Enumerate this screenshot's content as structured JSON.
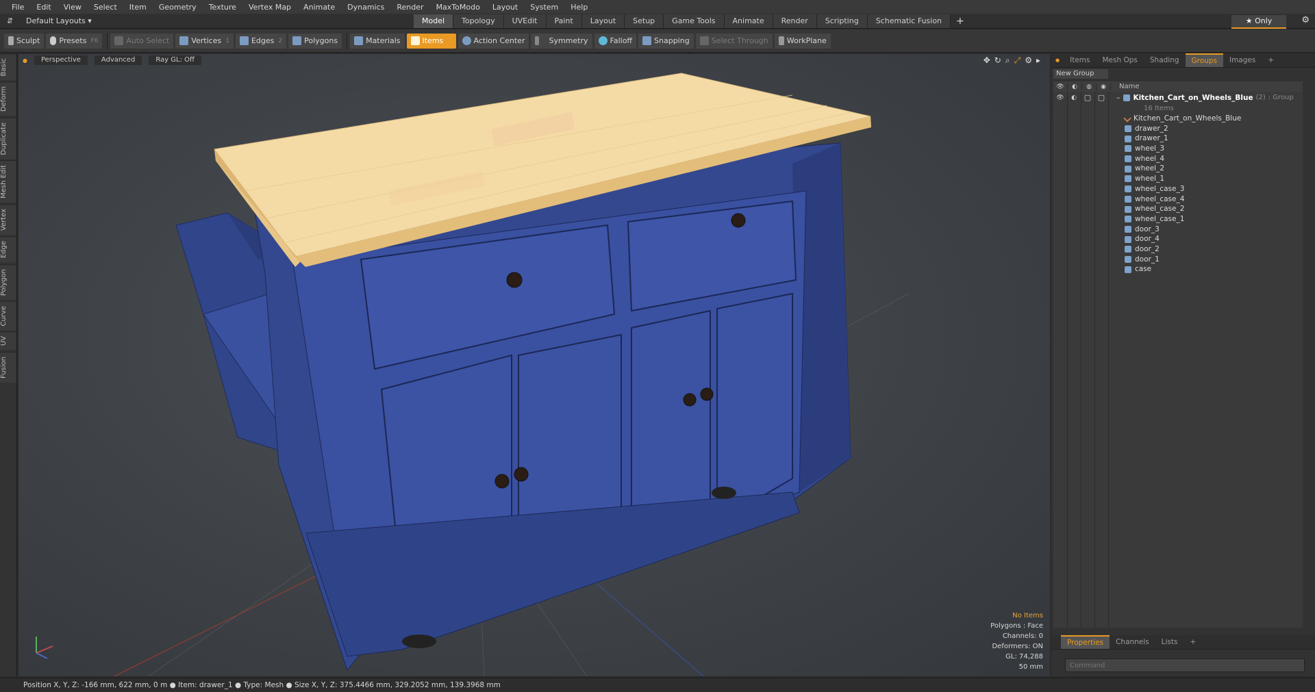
{
  "menu": [
    "File",
    "Edit",
    "View",
    "Select",
    "Item",
    "Geometry",
    "Texture",
    "Vertex Map",
    "Animate",
    "Dynamics",
    "Render",
    "MaxToModo",
    "Layout",
    "System",
    "Help"
  ],
  "layout_selector": "Default Layouts ▾",
  "layout_tabs": [
    {
      "label": "Model",
      "active": true
    },
    {
      "label": "Topology"
    },
    {
      "label": "UVEdit"
    },
    {
      "label": "Paint"
    },
    {
      "label": "Layout"
    },
    {
      "label": "Setup"
    },
    {
      "label": "Game Tools"
    },
    {
      "label": "Animate"
    },
    {
      "label": "Render"
    },
    {
      "label": "Scripting"
    },
    {
      "label": "Schematic Fusion"
    }
  ],
  "only_label": "★ Only",
  "toolbar": {
    "sculpt": "Sculpt",
    "presets": "Presets",
    "presets_key": "F6",
    "auto_select": "Auto Select",
    "vertices": "Vertices",
    "vertices_key": "1",
    "edges": "Edges",
    "edges_key": "2",
    "polygons": "Polygons",
    "materials": "Materials",
    "items": "Items",
    "action_center": "Action Center",
    "symmetry": "Symmetry",
    "falloff": "Falloff",
    "snapping": "Snapping",
    "select_through": "Select Through",
    "workplane": "WorkPlane"
  },
  "left_tabs": [
    "Basic",
    "Deform",
    "Duplicate",
    "Mesh Edit",
    "Vertex",
    "Edge",
    "Polygon",
    "Curve",
    "UV",
    "Fusion"
  ],
  "viewport": {
    "view": "Perspective",
    "shading": "Advanced",
    "raygl": "Ray GL: Off",
    "info": {
      "status": "No Items",
      "polygons": "Polygons : Face",
      "channels": "Channels: 0",
      "deformers": "Deformers: ON",
      "gl": "GL: 74,288",
      "scale": "50 mm"
    }
  },
  "right_tabs": [
    {
      "label": "Items"
    },
    {
      "label": "Mesh Ops"
    },
    {
      "label": "Shading"
    },
    {
      "label": "Groups",
      "active": true
    },
    {
      "label": "Images"
    }
  ],
  "new_group": "New Group",
  "col_name": "Name",
  "group": {
    "name": "Kitchen_Cart_on_Wheels_Blue",
    "count": "(2)",
    "type": ": Group",
    "items": "16 Items"
  },
  "tree_items": [
    "Kitchen_Cart_on_Wheels_Blue",
    "drawer_2",
    "drawer_1",
    "wheel_3",
    "wheel_4",
    "wheel_2",
    "wheel_1",
    "wheel_case_3",
    "wheel_case_4",
    "wheel_case_2",
    "wheel_case_1",
    "door_3",
    "door_4",
    "door_2",
    "door_1",
    "case"
  ],
  "bottom_tabs": [
    {
      "label": "Properties",
      "active": true
    },
    {
      "label": "Channels"
    },
    {
      "label": "Lists"
    }
  ],
  "command_placeholder": "Command",
  "status": "Position X, Y, Z:  -166 mm, 622 mm, 0 m ●  Item:  drawer_1 ●  Type:  Mesh ●  Size X, Y, Z:   375.4466 mm, 329.2052 mm, 139.3968 mm",
  "colors": {
    "accent": "#e89a24",
    "cart_blue": "#3b4f8e",
    "wood": "#f3d9a0"
  }
}
